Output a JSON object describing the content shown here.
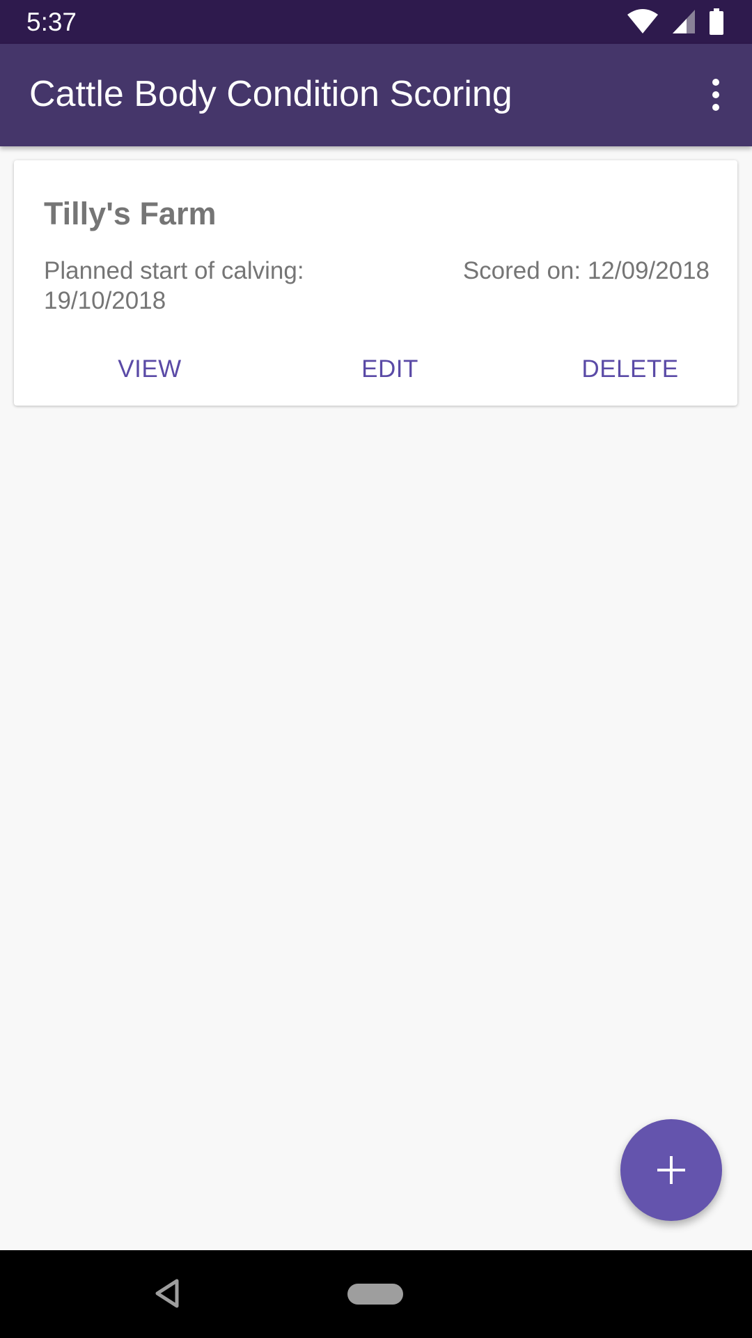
{
  "status_bar": {
    "time": "5:37",
    "icons": [
      "wifi-icon",
      "cell-signal-icon",
      "battery-icon"
    ]
  },
  "app_bar": {
    "title": "Cattle Body Condition Scoring",
    "menu_icon": "more-vert-icon"
  },
  "cards": [
    {
      "title": "Tilly's Farm",
      "calving_label": "Planned start of calving:",
      "calving_date": "19/10/2018",
      "scored_label": "Scored on: 12/09/2018",
      "actions": {
        "view": "VIEW",
        "edit": "EDIT",
        "delete": "DELETE"
      }
    }
  ],
  "fab": {
    "icon": "add-icon"
  },
  "nav_bar": {
    "back_icon": "back-triangle-icon",
    "home_icon": "home-pill-icon"
  },
  "colors": {
    "status_bar": "#2e1a4d",
    "app_bar": "#45366a",
    "accent": "#6454ad",
    "action_text": "#5a4aa6",
    "card_text": "#757575",
    "background": "#f8f8f8"
  }
}
